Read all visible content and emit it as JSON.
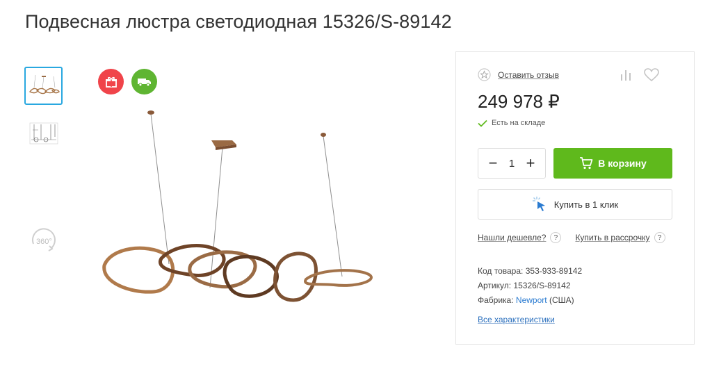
{
  "page": {
    "title": "Подвесная люстра светодиодная 15326/S-89142"
  },
  "gallery": {
    "thumbnails": [
      "chandelier-photo",
      "dimension-drawing"
    ],
    "view360_label": "360°",
    "badges": [
      "gift-icon",
      "delivery-truck-icon"
    ]
  },
  "buybox": {
    "review_link": "Оставить отзыв",
    "price": "249 978 ₽",
    "stock_status": "Есть на складе",
    "quantity": "1",
    "qty_minus": "−",
    "qty_plus": "+",
    "cart_button": "В корзину",
    "one_click_button": "Купить в 1 клик",
    "cheaper_link": "Нашли дешевле?",
    "installment_link": "Купить в рассрочку",
    "help_mark": "?",
    "specs": {
      "code_label": "Код товара:",
      "code_value": "353-933-89142",
      "article_label": "Артикул:",
      "article_value": "15326/S-89142",
      "factory_label": "Фабрика:",
      "factory_brand": "Newport",
      "factory_country": "(США)"
    },
    "all_specs_link": "Все характеристики"
  },
  "colors": {
    "accent_green": "#5fb91c",
    "gift_red": "#f0444a",
    "delivery_green": "#5fb532",
    "link_blue": "#2a7bd1",
    "thumb_active_border": "#29a8e0",
    "bronze": "#8a5a3a"
  }
}
